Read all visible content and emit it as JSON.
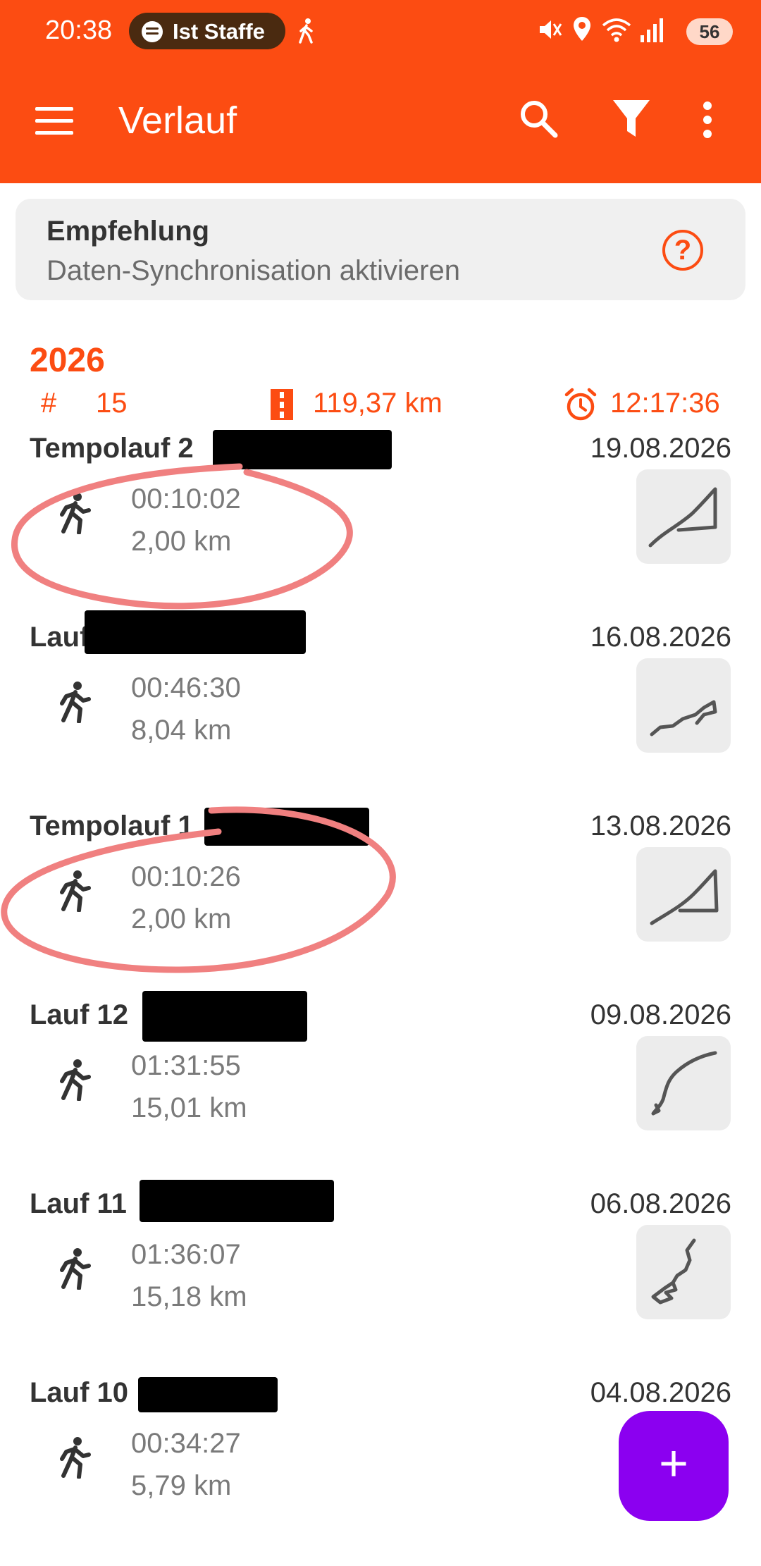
{
  "status_bar": {
    "time": "20:38",
    "media_pill": "Ist Staffe",
    "battery": "56"
  },
  "toolbar": {
    "title": "Verlauf",
    "icons": [
      "menu-icon",
      "search-icon",
      "filter-icon",
      "more-vert-icon"
    ]
  },
  "recommendation": {
    "title": "Empfehlung",
    "subtitle": "Daten-Synchronisation aktivieren",
    "help_symbol": "?"
  },
  "summary": {
    "year": "2026",
    "count_symbol": "#",
    "count": "15",
    "distance": "119,37 km",
    "duration": "12:17:36"
  },
  "activities": [
    {
      "name": "Tempolauf 2",
      "date": "19.08.2026",
      "time": "00:10:02",
      "distance": "2,00 km"
    },
    {
      "name": "Lauf",
      "date": "16.08.2026",
      "time": "00:46:30",
      "distance": "8,04 km"
    },
    {
      "name": "Tempolauf 1",
      "date": "13.08.2026",
      "time": "00:10:26",
      "distance": "2,00 km"
    },
    {
      "name": "Lauf 12",
      "date": "09.08.2026",
      "time": "01:31:55",
      "distance": "15,01 km"
    },
    {
      "name": "Lauf 11",
      "date": "06.08.2026",
      "time": "01:36:07",
      "distance": "15,18 km"
    },
    {
      "name": "Lauf 10",
      "date": "04.08.2026",
      "time": "00:34:27",
      "distance": "5,79 km"
    }
  ],
  "fab": {
    "label": "+"
  },
  "colors": {
    "brand": "#fc4c12",
    "fab": "#8b00f0",
    "annotation": "#f08080"
  }
}
